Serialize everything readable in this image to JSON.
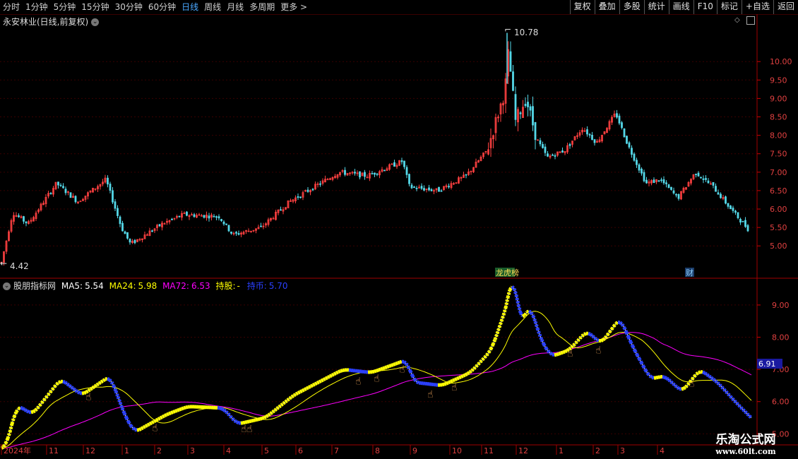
{
  "toolbar": {
    "periods": [
      "分时",
      "1分钟",
      "5分钟",
      "15分钟",
      "30分钟",
      "60分钟",
      "日线",
      "周线",
      "月线",
      "多周期",
      "更多 >"
    ],
    "active_period": "日线",
    "actions": [
      "复权",
      "叠加",
      "多股",
      "统计",
      "画线",
      "F10",
      "标记",
      "+自选",
      "返回"
    ]
  },
  "main_panel": {
    "title": "永安林业(日线,前复权)",
    "max_label": "10.78",
    "min_label": "4.42",
    "badge_lhb": "龙虎榜",
    "badge_cai": "财",
    "y_ticks": [
      "10.00",
      "9.50",
      "9.00",
      "8.50",
      "8.00",
      "7.50",
      "7.00",
      "6.50",
      "6.00",
      "5.50",
      "5.00"
    ]
  },
  "indicator_panel": {
    "name": "股朋指标网",
    "ma5_label": "MA5:",
    "ma5_value": "5.54",
    "ma24_label": "MA24:",
    "ma24_value": "5.98",
    "ma72_label": "MA72:",
    "ma72_value": "6.53",
    "hold_label": "持股:",
    "hold_value": "-",
    "coin_label": "持币:",
    "coin_value": "5.70",
    "current_tag": "6.91",
    "y_ticks": [
      "9.00",
      "8.00",
      "7.00",
      "6.00",
      "5.00"
    ]
  },
  "x_axis": {
    "labels": [
      "2024年",
      "11",
      "12",
      "1",
      "2",
      "3",
      "4",
      "5",
      "6",
      "7",
      "8",
      "9",
      "10",
      "11",
      "12",
      "1",
      "2",
      "3",
      "4"
    ]
  },
  "watermark": {
    "line1": "乐淘公式网",
    "line2": "www.60lt.com"
  },
  "colors": {
    "up": "#ff4040",
    "down": "#54d8e8",
    "ma5": "#ffffff",
    "ma24": "#ffff00",
    "ma72": "#ff00ff",
    "hold": "#ffff00",
    "coin": "#2a40ff",
    "active": "#4aa8ff"
  },
  "chart_data": {
    "type": "candlestick",
    "title": "永安林业(日线,前复权)",
    "y_range": [
      4.2,
      11.0
    ],
    "close_series": [
      {
        "x": "2024-10",
        "y": 4.6
      },
      {
        "x": "2024-11",
        "y": 6.7
      },
      {
        "x": "2024-12",
        "y": 6.9
      },
      {
        "x": "2025-01",
        "y": 5.1
      },
      {
        "x": "2025-02",
        "y": 5.8
      },
      {
        "x": "2025-03",
        "y": 5.9
      },
      {
        "x": "2025-04",
        "y": 5.5
      },
      {
        "x": "2025-05",
        "y": 6.6
      },
      {
        "x": "2025-06",
        "y": 7.0
      },
      {
        "x": "2025-07",
        "y": 7.1
      },
      {
        "x": "2025-08",
        "y": 6.7
      },
      {
        "x": "2025-09",
        "y": 6.7
      },
      {
        "x": "2025-10",
        "y": 8.0
      },
      {
        "x": "2025-11",
        "y": 10.78
      },
      {
        "x": "2025-12",
        "y": 7.6
      },
      {
        "x": "2026-01",
        "y": 8.3
      },
      {
        "x": "2026-02",
        "y": 6.4
      },
      {
        "x": "2026-03",
        "y": 6.9
      },
      {
        "x": "2026-04",
        "y": 5.5
      }
    ],
    "indicator": {
      "series": [
        {
          "name": "MA5",
          "last": 5.54
        },
        {
          "name": "MA24",
          "last": 5.98
        },
        {
          "name": "MA72",
          "last": 6.53
        }
      ],
      "y_range": [
        4.7,
        9.7
      ]
    }
  }
}
